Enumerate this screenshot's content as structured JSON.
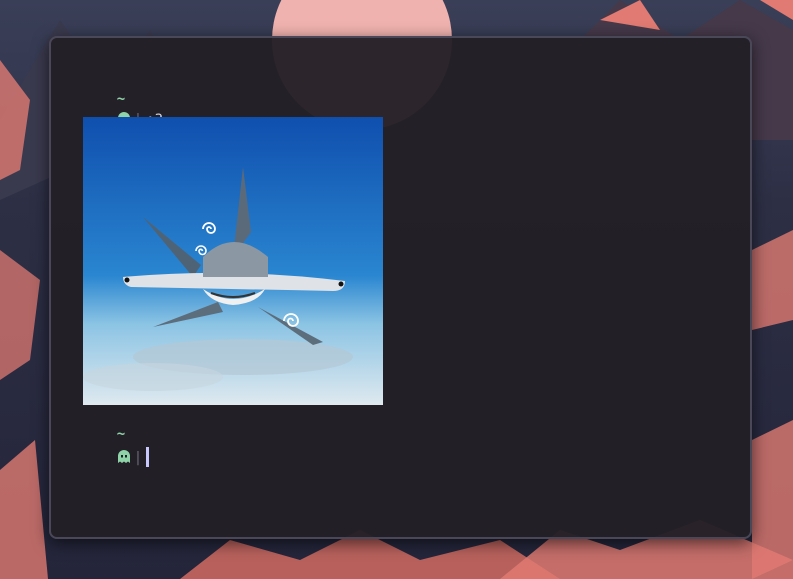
{
  "prompt": {
    "dir": "~",
    "separator": "|",
    "icon": "ghost-icon",
    "icon_color": "#8fd3a8"
  },
  "history": [
    {
      "command": ":3"
    }
  ],
  "image": {
    "subject": "hammerhead-shark",
    "background_top": "#0f4fae",
    "background_bottom": "#dfe9ef"
  },
  "colors": {
    "terminal_bg": "#231f26",
    "accent_pink": "#e07a72",
    "cursor": "#c8c8ff"
  }
}
